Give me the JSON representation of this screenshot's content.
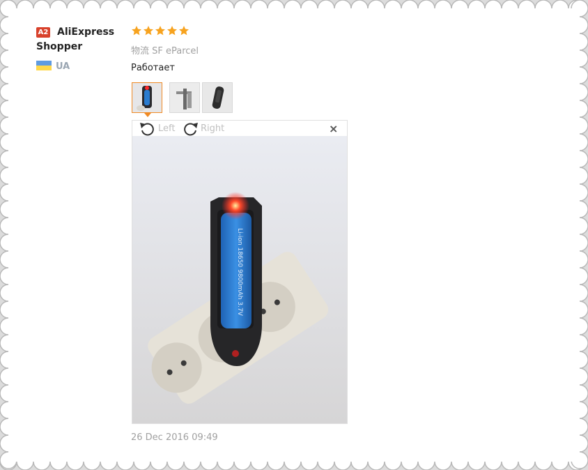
{
  "user": {
    "badge": "A2",
    "name": "AliExpress Shopper",
    "country": "UA",
    "flag_colors": [
      "#5f9be0",
      "#ffd84a"
    ]
  },
  "review": {
    "rating": 5,
    "rating_max": 5,
    "star_color": "#f7a31f",
    "logistics": "物流 SF eParcel",
    "text": "Работает",
    "date": "26 Dec 2016 09:49"
  },
  "thumbnails": [
    {
      "name": "charger-in-socket-thumb",
      "selected": true
    },
    {
      "name": "charger-side-thumb",
      "selected": false
    },
    {
      "name": "charger-black-thumb",
      "selected": false
    }
  ],
  "viewer": {
    "rotate_left_label": "Left",
    "rotate_right_label": "Right",
    "close_label": "×"
  },
  "photo": {
    "battery_print": "Li-ion 18650 9800mAh 3.7V"
  },
  "colors": {
    "accent": "#f08a24",
    "battery_blue": "#2a7cd0",
    "led_red": "#ff2a2a"
  }
}
